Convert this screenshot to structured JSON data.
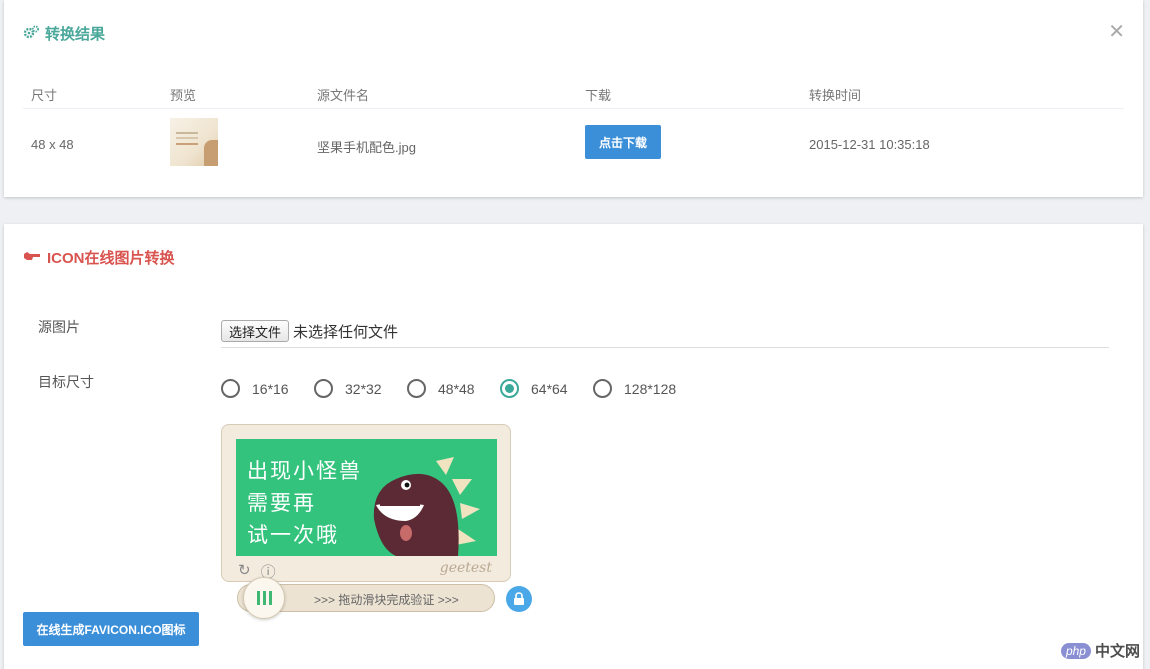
{
  "result_panel": {
    "title": "转换结果",
    "close_icon": "close-icon",
    "columns": [
      "尺寸",
      "预览",
      "源文件名",
      "下载",
      "转换时间"
    ],
    "row": {
      "size": "48 x 48",
      "filename": "坚果手机配色.jpg",
      "download_label": "点击下载",
      "time": "2015-12-31 10:35:18"
    }
  },
  "convert_panel": {
    "title": "ICON在线图片转换",
    "source_label": "源图片",
    "file_button": "选择文件",
    "file_status": "未选择任何文件",
    "size_label": "目标尺寸",
    "sizes": [
      "16*16",
      "32*32",
      "48*48",
      "64*64",
      "128*128"
    ],
    "selected_size": "64*64",
    "captcha": {
      "line1": "出现小怪兽",
      "line2": "需要再",
      "line3": "试一次哦",
      "brand": "geetest",
      "slider_text": ">>> 拖动滑块完成验证 >>>"
    },
    "generate_label": "在线生成FAVICON.ICO图标"
  },
  "watermark": {
    "php": "php",
    "site": "中文网"
  },
  "colors": {
    "teal": "#4aa89a",
    "red": "#d9534f",
    "blue": "#3b8fd9",
    "captcha_green": "#33c37d"
  }
}
